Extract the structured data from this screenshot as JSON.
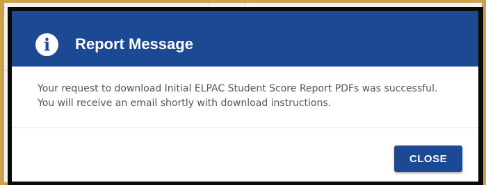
{
  "dialog": {
    "title": "Report Message",
    "icon": "info-icon",
    "icon_glyph": "i",
    "message": "Your request to download Initial ELPAC Student Score Report PDFs was successful. You will receive an email shortly with download instructions.",
    "close_label": "CLOSE"
  },
  "colors": {
    "header": "#1c4993",
    "button": "#1c4993",
    "backdrop_border": "#c9a24a",
    "frame": "#0a0a0a"
  },
  "background": {
    "corner_glyph": "<"
  }
}
